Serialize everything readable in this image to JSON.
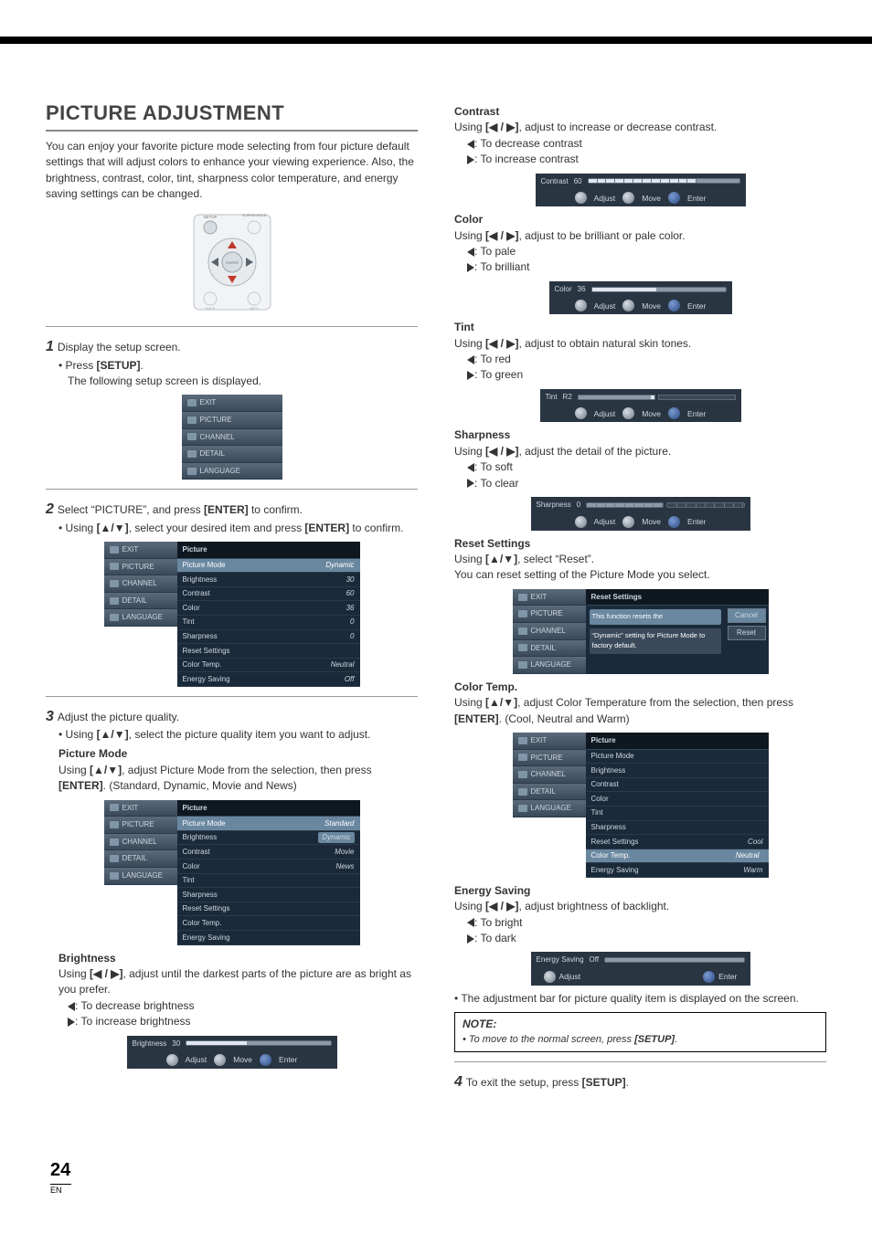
{
  "left": {
    "h1": "PICTURE ADJUSTMENT",
    "intro": "You can enjoy your favorite picture mode selecting from four picture default settings that will adjust colors to enhance your viewing experience. Also, the brightness, contrast, color, tint, sharpness color temperature, and energy saving settings can be changed.",
    "remote": {
      "labels": {
        "setup": "SETUP",
        "screen": "SCREEN MODE",
        "enter": "ENTER",
        "back": "BACK",
        "info": "INFO"
      }
    },
    "step1": {
      "num": "1",
      "text": "Display the setup screen.",
      "b1": "• Press ",
      "b1b": "[SETUP]",
      "b1t": ".",
      "b2": "The following setup screen is displayed."
    },
    "menu_tabs": [
      "EXIT",
      "PICTURE",
      "CHANNEL",
      "DETAIL",
      "LANGUAGE"
    ],
    "step2": {
      "num": "2",
      "text": "Select “PICTURE”, and press ",
      "eb": "[ENTER]",
      "text2": " to confirm.",
      "b1": "• Using ",
      "kb": "[▲/▼]",
      "b1t": ", select your desired item and press ",
      "eb2": "[ENTER]",
      "b1e": " to confirm."
    },
    "osd1": {
      "title": "Picture",
      "rows": [
        {
          "l": "Picture Mode",
          "r": "Dynamic",
          "sel": true
        },
        {
          "l": "Brightness",
          "r": "30"
        },
        {
          "l": "Contrast",
          "r": "60"
        },
        {
          "l": "Color",
          "r": "36"
        },
        {
          "l": "Tint",
          "r": "0"
        },
        {
          "l": "Sharpness",
          "r": "0"
        },
        {
          "l": "Reset Settings",
          "r": ""
        },
        {
          "l": "Color Temp.",
          "r": "Neutral"
        },
        {
          "l": "Energy Saving",
          "r": "Off"
        }
      ]
    },
    "step3": {
      "num": "3",
      "text": "Adjust the picture quality.",
      "b1": "• Using ",
      "kb": "[▲/▼]",
      "b1t": ", select the picture quality item you want to adjust."
    },
    "pm": {
      "h": "Picture Mode",
      "t1": "Using ",
      "kb": "[▲/▼]",
      "t2": ", adjust Picture Mode from the selection, then press ",
      "eb": "[ENTER]",
      "t3": ". (Standard, Dynamic, Movie and News)"
    },
    "osd2": {
      "title": "Picture",
      "rows": [
        {
          "l": "Picture Mode",
          "r": "Standard",
          "sel": true
        },
        {
          "l": "Brightness",
          "r": "Dynamic",
          "rsel": true
        },
        {
          "l": "Contrast",
          "r": "Movie"
        },
        {
          "l": "Color",
          "r": "News"
        },
        {
          "l": "Tint",
          "r": ""
        },
        {
          "l": "Sharpness",
          "r": ""
        },
        {
          "l": "Reset Settings",
          "r": ""
        },
        {
          "l": "Color Temp.",
          "r": ""
        },
        {
          "l": "Energy Saving",
          "r": ""
        }
      ]
    },
    "br": {
      "h": "Brightness",
      "t": "Using ",
      "kb": "[◀ / ▶]",
      "t2": ", adjust until the darkest parts of the picture are as bright as you prefer.",
      "l1": ": To decrease brightness",
      "l2": ": To increase brightness",
      "bar": {
        "label": "Brightness",
        "val": "30",
        "fill": 42
      }
    }
  },
  "right": {
    "co": {
      "h": "Contrast",
      "t": "Using ",
      "kb": "[◀ / ▶]",
      "t2": ", adjust to increase or decrease contrast.",
      "l1": ": To decrease contrast",
      "l2": ": To increase contrast",
      "bar": {
        "label": "Contrast",
        "val": "60",
        "fill": 72,
        "grid": true
      }
    },
    "cl": {
      "h": "Color",
      "t": "Using ",
      "kb": "[◀ / ▶]",
      "t2": ", adjust to be brilliant or pale color.",
      "l1": ": To pale",
      "l2": ": To brilliant",
      "bar": {
        "label": "Color",
        "val": "36",
        "fill": 48
      }
    },
    "ti": {
      "h": "Tint",
      "t": "Using ",
      "kb": "[◀ / ▶]",
      "t2": ", adjust to obtain natural skin tones.",
      "l1": ": To red",
      "l2": ": To green",
      "bar": {
        "label": "Tint",
        "val": "R2",
        "half": true
      }
    },
    "sh": {
      "h": "Sharpness",
      "t": "Using ",
      "kb": "[◀ / ▶]",
      "t2": ", adjust the detail of the picture.",
      "l1": ": To soft",
      "l2": ": To clear",
      "bar": {
        "label": "Sharpness",
        "val": "0",
        "grid2": true
      }
    },
    "rs": {
      "h": "Reset Settings",
      "t": "Using ",
      "kb": "[▲/▼]",
      "t2": ", select “Reset”.",
      "t3": "You can reset setting of the Picture Mode you select.",
      "osd": {
        "title": "Reset Settings",
        "desc1": "This function resets the",
        "desc2": "“Dynamic” setting for Picture Mode to factory default.",
        "b1": "Cancel",
        "b2": "Reset"
      }
    },
    "ct": {
      "h": "Color Temp.",
      "t": "Using ",
      "kb": "[▲/▼]",
      "t2": ", adjust Color Temperature from the selection, then press ",
      "eb": "[ENTER]",
      "t3": ". (Cool, Neutral and Warm)",
      "osd": {
        "title": "Picture",
        "rows": [
          {
            "l": "Picture Mode",
            "r": ""
          },
          {
            "l": "Brightness",
            "r": ""
          },
          {
            "l": "Contrast",
            "r": ""
          },
          {
            "l": "Color",
            "r": ""
          },
          {
            "l": "Tint",
            "r": ""
          },
          {
            "l": "Sharpness",
            "r": ""
          },
          {
            "l": "Reset Settings",
            "r": "Cool"
          },
          {
            "l": "Color Temp.",
            "r": "Neutral",
            "rsel": true,
            "sel": true
          },
          {
            "l": "Energy Saving",
            "r": "Warm"
          }
        ]
      }
    },
    "es": {
      "h": "Energy Saving",
      "t": "Using ",
      "kb": "[◀ / ▶]",
      "t2": ", adjust brightness of backlight.",
      "l1": ": To bright",
      "l2": ": To dark",
      "bar": {
        "label": "Energy Saving",
        "val": "Off",
        "fill": 0,
        "enterOnly": true
      },
      "bul": "• The adjustment bar for picture quality item is displayed on the screen."
    },
    "note": {
      "h": "NOTE:",
      "t": "• To move to the normal screen, press ",
      "b": "[SETUP]",
      "e": "."
    },
    "step4": {
      "num": "4",
      "text": "To exit the setup, press ",
      "b": "[SETUP]",
      "e": "."
    }
  },
  "help": {
    "adjust": "Adjust",
    "move": "Move",
    "enter": "Enter"
  },
  "page": {
    "num": "24",
    "lang": "EN"
  }
}
